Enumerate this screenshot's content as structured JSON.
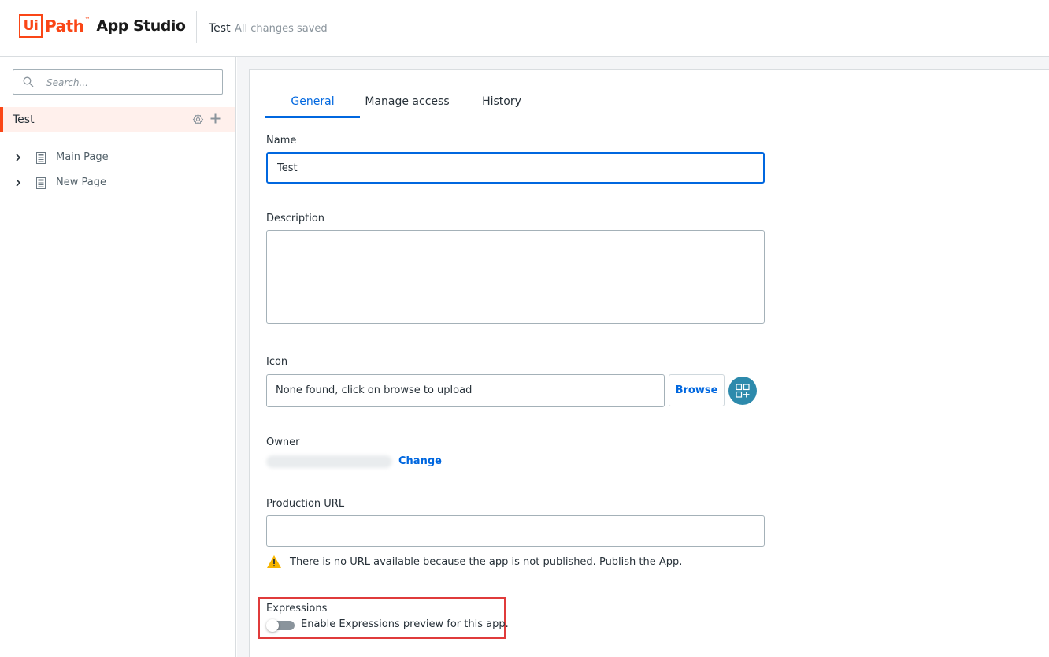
{
  "header": {
    "logo_ui": "Ui",
    "logo_path": "Path",
    "logo_tm": "™",
    "logo_app": "App Studio",
    "title": "Test",
    "status": "All changes saved"
  },
  "sidebar": {
    "search_placeholder": "Search...",
    "app_name": "Test",
    "pages": [
      {
        "label": "Main Page"
      },
      {
        "label": "New Page"
      }
    ]
  },
  "tabs": [
    {
      "label": "General",
      "active": true
    },
    {
      "label": "Manage access",
      "active": false
    },
    {
      "label": "History",
      "active": false
    }
  ],
  "form": {
    "name_label": "Name",
    "name_value": "Test",
    "description_label": "Description",
    "description_value": "",
    "icon_label": "Icon",
    "icon_placeholder": "None found, click on browse to upload",
    "browse_label": "Browse",
    "owner_label": "Owner",
    "change_label": "Change",
    "production_url_label": "Production URL",
    "production_url_value": "",
    "url_warning": "There is no URL available because the app is not published. Publish the App.",
    "expressions_label": "Expressions",
    "expressions_toggle_label": "Enable Expressions preview for this app.",
    "expressions_enabled": false
  },
  "colors": {
    "brand": "#fa4616",
    "accent": "#0067df",
    "highlight": "#e03b3b",
    "warning": "#f7b500"
  }
}
